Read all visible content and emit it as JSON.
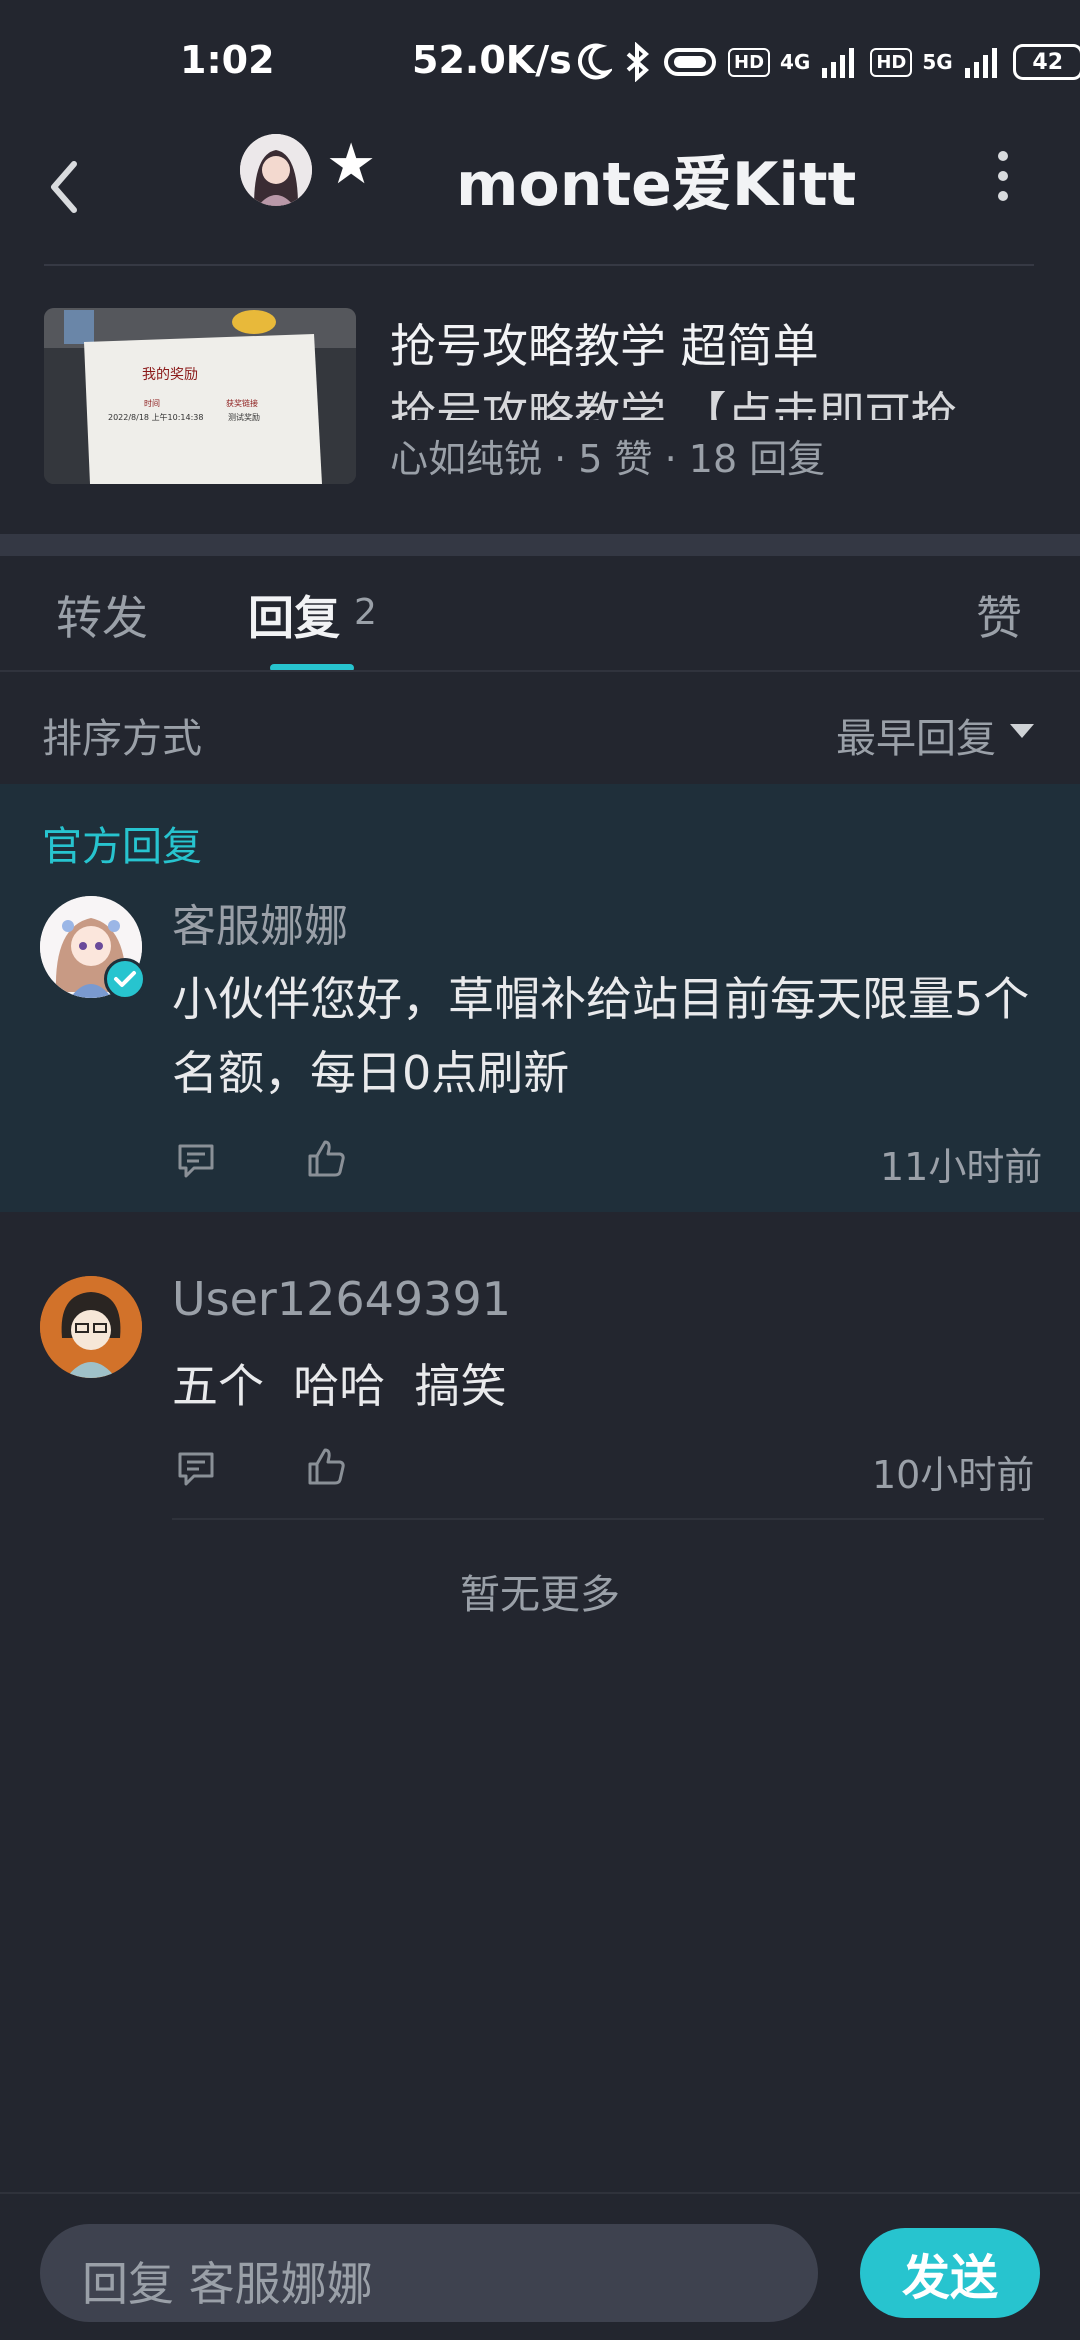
{
  "status_bar": {
    "time": "1:02",
    "network_speed": "52.0K/s",
    "net1": "4G",
    "net2": "5G",
    "hd": "HD",
    "battery": "42"
  },
  "header": {
    "title": "monte爱Kitt",
    "star": "★"
  },
  "post": {
    "title": "抢号攻略教学 超简单",
    "subtitle": "抢号攻略教学 【点击即可抢",
    "author": "心如纯锐",
    "meta_sep": " · ",
    "likes": "5 赞",
    "replies": "18 回复",
    "thumb_text": {
      "heading": "我的奖励",
      "col1_label": "时间",
      "col1_value": "2022/8/18 上午10:14:38",
      "col2_label": "获奖链接",
      "col2_value": "测试奖励"
    }
  },
  "tabs": {
    "forward": "转发",
    "reply": "回复",
    "reply_count": "2",
    "like": "赞"
  },
  "sort": {
    "label": "排序方式",
    "value": "最早回复"
  },
  "official": {
    "label": "官方回复",
    "name": "客服娜娜",
    "text": "小伙伴您好，草帽补给站目前每天限量5个名额，每日0点刷新",
    "time": "11小时前"
  },
  "reply2": {
    "name": "User12649391",
    "text": "五个  哈哈  搞笑",
    "time": "10小时前"
  },
  "no_more": "暂无更多",
  "bottom": {
    "placeholder": "回复 客服娜娜",
    "send": "发送"
  },
  "colors": {
    "accent": "#27c4cf",
    "background": "#23262f",
    "official_bg": "#1f2f3a"
  }
}
